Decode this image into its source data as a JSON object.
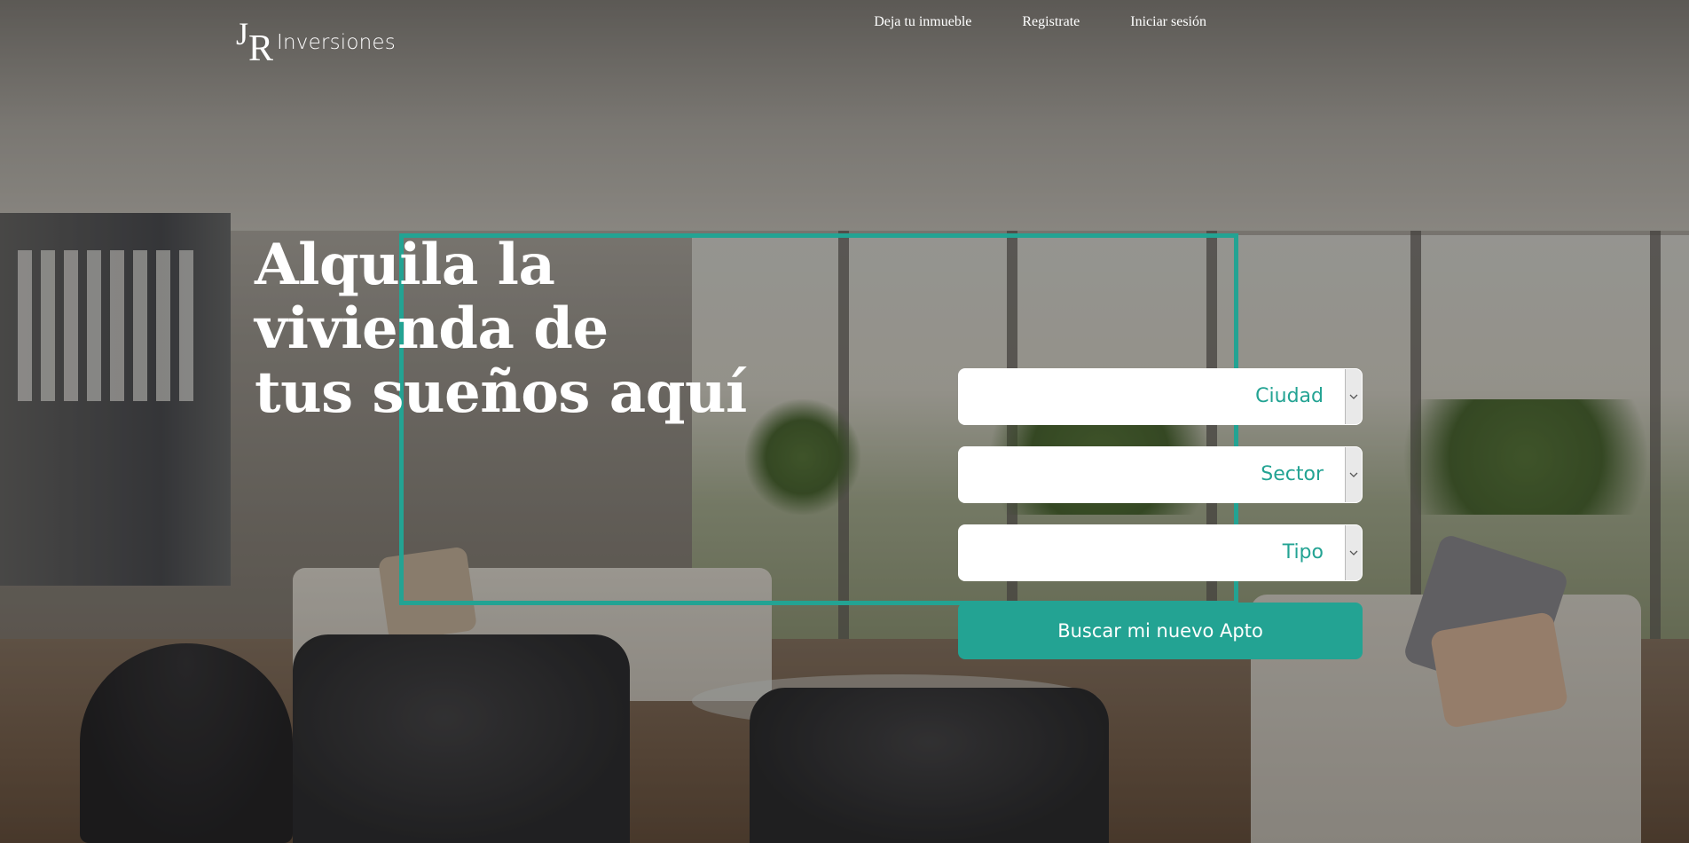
{
  "brand": {
    "logo_mark_j": "J",
    "logo_mark_r": "R",
    "name": "Inversiones"
  },
  "nav": {
    "items": [
      {
        "label": "Deja tu inmueble"
      },
      {
        "label": "Registrate"
      },
      {
        "label": "Iniciar sesión"
      }
    ]
  },
  "hero": {
    "headline_lines": [
      "Alquila la",
      "vivienda de",
      "tus sueños aquí"
    ]
  },
  "search": {
    "city": {
      "value": "Ciudad"
    },
    "sector": {
      "value": "Sector"
    },
    "type": {
      "value": "Tipo"
    },
    "button_label": "Buscar mi nuevo Apto"
  },
  "colors": {
    "accent": "#23a393",
    "text_light": "#ffffff",
    "select_bg": "#ffffff"
  },
  "icons": {
    "select_arrow": "chevron-down-icon",
    "background": "living-room-photo"
  }
}
